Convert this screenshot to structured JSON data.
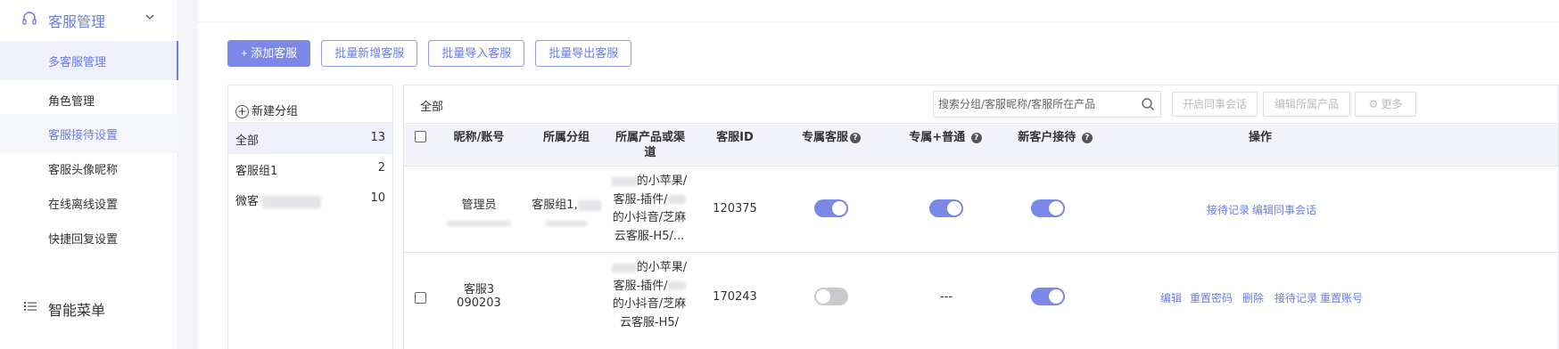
{
  "sidebar": {
    "group_label": "客服管理",
    "items": [
      {
        "label": "多客服管理"
      },
      {
        "label": "角色管理"
      },
      {
        "label": "客服接待设置"
      },
      {
        "label": "客服头像昵称"
      },
      {
        "label": "在线离线设置"
      },
      {
        "label": "快捷回复设置"
      }
    ],
    "group2_label": "智能菜单"
  },
  "toolbar": {
    "add_label": "+ 添加客服",
    "batch_add_label": "批量新增客服",
    "batch_import_label": "批量导入客服",
    "batch_export_label": "批量导出客服"
  },
  "groups": {
    "new_label": "新建分组",
    "items": [
      {
        "name": "全部",
        "count": "13"
      },
      {
        "name": "客服组1",
        "count": "2"
      },
      {
        "name": "微客",
        "count": "10"
      }
    ]
  },
  "table": {
    "current_group": "全部",
    "search_placeholder": "搜索分组/客服昵称/客服所在产品",
    "header_buttons": {
      "enable_chat": "开启同事会话",
      "edit_products": "编辑所属产品",
      "more": "更多"
    },
    "columns": {
      "nickname": "昵称/账号",
      "group": "所属分组",
      "product_l1": "所属产品或渠",
      "product_l2": "道",
      "id": "客服ID",
      "exclusive": "专属客服",
      "exclusive_normal": "专属+普通",
      "new_customer": "新客户接待",
      "actions": "操作"
    },
    "rows": [
      {
        "nickname": "管理员",
        "group": "客服组1,",
        "product_lines": [
          "的小苹果/",
          "客服-插件/",
          "的小抖音/芝麻",
          "云客服-H5/..."
        ],
        "id": "120375",
        "exclusive": true,
        "exclusive_normal_on": true,
        "new_customer": true,
        "actions": [
          "接待记录",
          "编辑同事会话"
        ]
      },
      {
        "nickname_l1": "客服3",
        "nickname_l2": "090203",
        "product_lines": [
          "的小苹果/",
          "客服-插件/",
          "的小抖音/芝麻",
          "云客服-H5/"
        ],
        "id": "170243",
        "exclusive": false,
        "exclusive_normal": "---",
        "new_customer": true,
        "actions": [
          "编辑",
          "重置密码",
          "删除",
          "接待记录",
          "重置账号"
        ]
      }
    ]
  },
  "colors": {
    "accent": "#7b88e8",
    "link": "#6b7de0",
    "toggle_off": "#c8c9cc"
  },
  "icons": [
    "headset-icon",
    "chevron-up-icon",
    "menu-list-icon",
    "plus-circle-icon",
    "search-icon",
    "gear-icon",
    "help-icon"
  ]
}
